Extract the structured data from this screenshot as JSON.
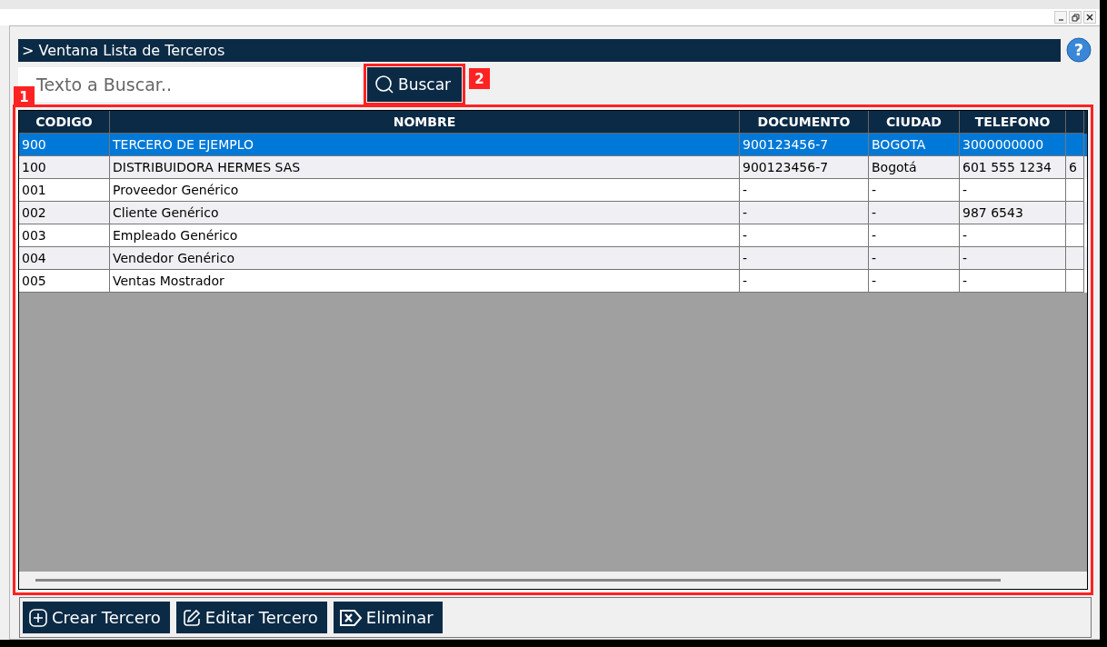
{
  "panel": {
    "title": "> Ventana Lista de Terceros",
    "help": "?"
  },
  "search": {
    "placeholder": "Texto a Buscar..",
    "button": "Buscar"
  },
  "annotations": [
    {
      "label": "1"
    },
    {
      "label": "2"
    }
  ],
  "table": {
    "columns": [
      "CODIGO",
      "NOMBRE",
      "DOCUMENTO",
      "CIUDAD",
      "TELEFONO"
    ],
    "rows": [
      {
        "selected": true,
        "cells": [
          "900",
          "TERCERO DE EJEMPLO",
          "900123456-7",
          "BOGOTA",
          "3000000000"
        ]
      },
      {
        "selected": false,
        "cells": [
          "100",
          "DISTRIBUIDORA HERMES SAS",
          "900123456-7",
          "Bogotá",
          "601 555 1234"
        ],
        "column_6": "6"
      },
      {
        "selected": false,
        "cells": [
          "001",
          "Proveedor Genérico",
          "-",
          "-",
          "-"
        ]
      },
      {
        "selected": false,
        "cells": [
          "002",
          "Cliente Genérico",
          "-",
          "-",
          "987 6543"
        ]
      },
      {
        "selected": false,
        "cells": [
          "003",
          "Empleado Genérico",
          "-",
          "-",
          "-"
        ]
      },
      {
        "selected": false,
        "cells": [
          "004",
          "Vendedor Genérico",
          "-",
          "-",
          "-"
        ]
      },
      {
        "selected": false,
        "cells": [
          "005",
          "Ventas Mostrador",
          "-",
          "-",
          "-"
        ]
      }
    ]
  },
  "buttons": [
    {
      "kind": "create",
      "label": "Crear Tercero"
    },
    {
      "kind": "edit",
      "label": "Editar Tercero"
    },
    {
      "kind": "delete",
      "label": "Eliminar"
    }
  ]
}
